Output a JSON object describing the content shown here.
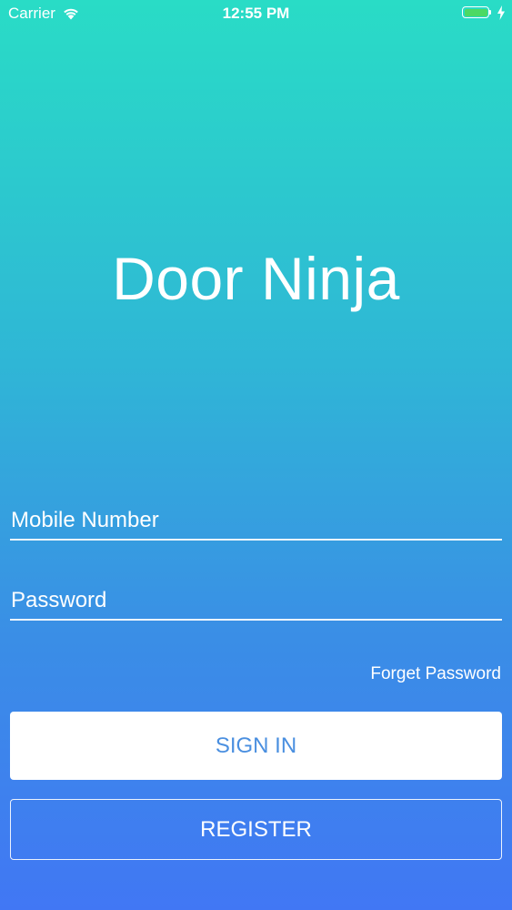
{
  "status_bar": {
    "carrier": "Carrier",
    "time": "12:55 PM",
    "battery_level": 1.0,
    "battery_color": "#4cd964"
  },
  "app": {
    "title": "Door Ninja"
  },
  "form": {
    "mobile_placeholder": "Mobile Number",
    "mobile_value": "",
    "password_placeholder": "Password",
    "password_value": "",
    "forgot_label": "Forget Password",
    "sign_in_label": "SIGN IN",
    "register_label": "REGISTER"
  },
  "colors": {
    "gradient_top": "#29dcc6",
    "gradient_bottom": "#4177f4",
    "sign_in_text": "#4a8fe0"
  },
  "icons": {
    "wifi": "wifi-icon",
    "battery": "battery-icon",
    "charging": "charging-bolt-icon"
  }
}
